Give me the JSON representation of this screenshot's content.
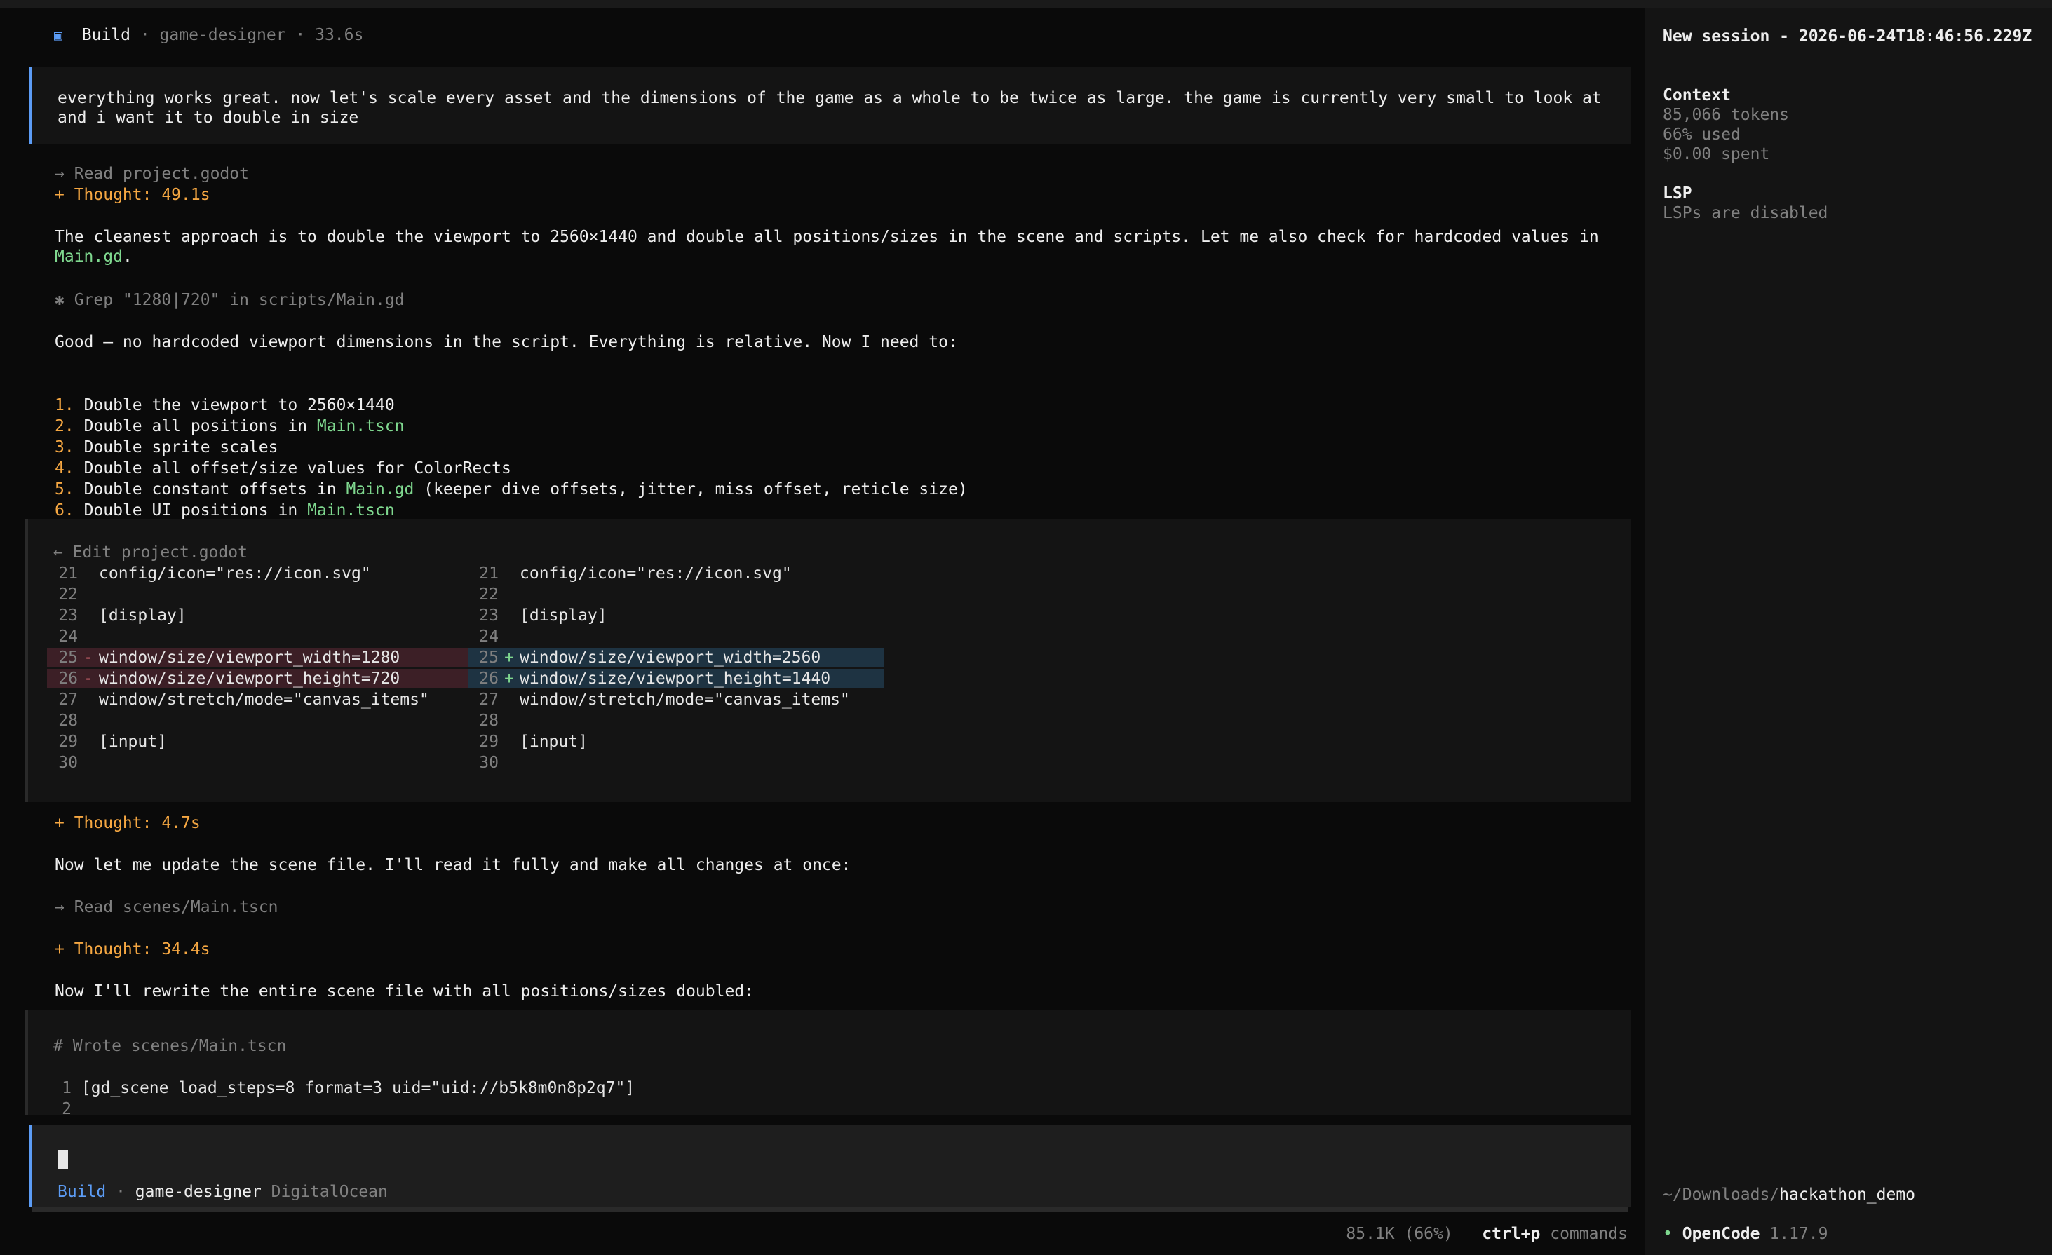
{
  "header": {
    "icon": "square-icon",
    "mode": "Build",
    "agent": "game-designer",
    "duration": "33.6s"
  },
  "user_message": "everything works great. now let's scale every asset and the dimensions of the game as a whole to be twice as large. the game is currently very small to look at and i want it to double in size",
  "events": {
    "read1": {
      "arrow": "→",
      "text": "Read project.godot"
    },
    "thought1": "+ Thought: 49.1s",
    "para1_text": "The cleanest approach is to double the viewport to 2560×1440 and double all positions/sizes in the scene and scripts. Let me also check for hardcoded values in ",
    "para1_file": "Main.gd",
    "para1_end": ".",
    "grep": {
      "icon": "✱",
      "text": "Grep \"1280|720\" in scripts/Main.gd"
    },
    "para2": "Good — no hardcoded viewport dimensions in the script. Everything is relative. Now I need to:",
    "list": [
      {
        "num": "1.",
        "pre": "Double the viewport to 2560×1440",
        "file": "",
        "post": ""
      },
      {
        "num": "2.",
        "pre": "Double all positions in ",
        "file": "Main.tscn",
        "post": ""
      },
      {
        "num": "3.",
        "pre": "Double sprite scales",
        "file": "",
        "post": ""
      },
      {
        "num": "4.",
        "pre": "Double all offset/size values for ColorRects",
        "file": "",
        "post": ""
      },
      {
        "num": "5.",
        "pre": "Double constant offsets in ",
        "file": "Main.gd",
        "post": " (keeper dive offsets, jitter, miss offset, reticle size)"
      },
      {
        "num": "6.",
        "pre": "Double UI positions in ",
        "file": "Main.tscn",
        "post": ""
      }
    ],
    "edit_title": "← Edit project.godot",
    "diff_left": [
      {
        "n": "21",
        "s": "",
        "t": "config/icon=\"res://icon.svg\"",
        "k": ""
      },
      {
        "n": "22",
        "s": "",
        "t": "",
        "k": ""
      },
      {
        "n": "23",
        "s": "",
        "t": "[display]",
        "k": ""
      },
      {
        "n": "24",
        "s": "",
        "t": "",
        "k": ""
      },
      {
        "n": "25",
        "s": "-",
        "t": "window/size/viewport_width=1280",
        "k": "rem"
      },
      {
        "n": "26",
        "s": "-",
        "t": "window/size/viewport_height=720",
        "k": "rem"
      },
      {
        "n": "27",
        "s": "",
        "t": "window/stretch/mode=\"canvas_items\"",
        "k": ""
      },
      {
        "n": "28",
        "s": "",
        "t": "",
        "k": ""
      },
      {
        "n": "29",
        "s": "",
        "t": "[input]",
        "k": ""
      },
      {
        "n": "30",
        "s": "",
        "t": "",
        "k": ""
      }
    ],
    "diff_right": [
      {
        "n": "21",
        "s": "",
        "t": "config/icon=\"res://icon.svg\"",
        "k": ""
      },
      {
        "n": "22",
        "s": "",
        "t": "",
        "k": ""
      },
      {
        "n": "23",
        "s": "",
        "t": "[display]",
        "k": ""
      },
      {
        "n": "24",
        "s": "",
        "t": "",
        "k": ""
      },
      {
        "n": "25",
        "s": "+",
        "t": "window/size/viewport_width=2560",
        "k": "add"
      },
      {
        "n": "26",
        "s": "+",
        "t": "window/size/viewport_height=1440",
        "k": "add"
      },
      {
        "n": "27",
        "s": "",
        "t": "window/stretch/mode=\"canvas_items\"",
        "k": ""
      },
      {
        "n": "28",
        "s": "",
        "t": "",
        "k": ""
      },
      {
        "n": "29",
        "s": "",
        "t": "[input]",
        "k": ""
      },
      {
        "n": "30",
        "s": "",
        "t": "",
        "k": ""
      }
    ],
    "thought2": "+ Thought: 4.7s",
    "para3": "Now let me update the scene file. I'll read it fully and make all changes at once:",
    "read2": {
      "arrow": "→",
      "text": "Read scenes/Main.tscn"
    },
    "thought3": "+ Thought: 34.4s",
    "para4": "Now I'll rewrite the entire scene file with all positions/sizes doubled:",
    "wrote_title": "# Wrote scenes/Main.tscn",
    "wrote_lines": [
      {
        "n": "1",
        "t": "[gd_scene load_steps=8 format=3 uid=\"uid://b5k8m0n8p2q7\"]"
      },
      {
        "n": "2",
        "t": ""
      }
    ]
  },
  "input": {
    "mode": "Build",
    "agent": "game-designer",
    "provider": "DigitalOcean"
  },
  "statusbar": {
    "usage": "85.1K (66%)",
    "shortcut": "ctrl+p",
    "shortcut_label": "commands"
  },
  "sidebar": {
    "title": "New session - 2026-06-24T18:46:56.229Z",
    "context_heading": "Context",
    "tokens": "85,066 tokens",
    "used": "66% used",
    "spent": "$0.00 spent",
    "lsp_heading": "LSP",
    "lsp_status": "LSPs are disabled",
    "path_prefix": "~/Downloads/",
    "path_dir": "hackathon_demo",
    "app_dot": "•",
    "app_name": "OpenCode",
    "app_version": "1.17.9"
  },
  "colors": {
    "accent": "#5c9cf5",
    "thought": "#f5a742",
    "file": "#7fd88f",
    "removed_bg": "#3c1f26",
    "added_bg": "#1e3342"
  }
}
